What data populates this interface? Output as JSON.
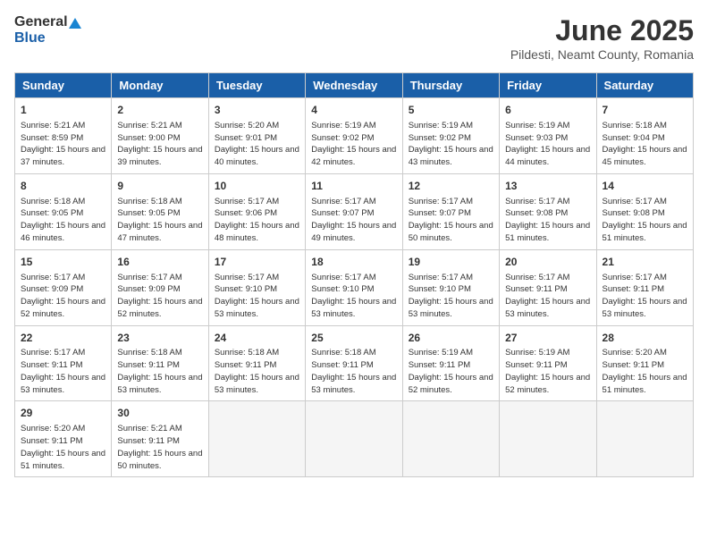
{
  "header": {
    "logo_general": "General",
    "logo_blue": "Blue",
    "title": "June 2025",
    "subtitle": "Pildesti, Neamt County, Romania"
  },
  "calendar": {
    "days_of_week": [
      "Sunday",
      "Monday",
      "Tuesday",
      "Wednesday",
      "Thursday",
      "Friday",
      "Saturday"
    ],
    "weeks": [
      [
        {
          "day": "",
          "info": ""
        },
        {
          "day": "2",
          "info": "Sunrise: 5:21 AM\nSunset: 9:00 PM\nDaylight: 15 hours\nand 39 minutes."
        },
        {
          "day": "3",
          "info": "Sunrise: 5:20 AM\nSunset: 9:01 PM\nDaylight: 15 hours\nand 40 minutes."
        },
        {
          "day": "4",
          "info": "Sunrise: 5:19 AM\nSunset: 9:02 PM\nDaylight: 15 hours\nand 42 minutes."
        },
        {
          "day": "5",
          "info": "Sunrise: 5:19 AM\nSunset: 9:02 PM\nDaylight: 15 hours\nand 43 minutes."
        },
        {
          "day": "6",
          "info": "Sunrise: 5:19 AM\nSunset: 9:03 PM\nDaylight: 15 hours\nand 44 minutes."
        },
        {
          "day": "7",
          "info": "Sunrise: 5:18 AM\nSunset: 9:04 PM\nDaylight: 15 hours\nand 45 minutes."
        }
      ],
      [
        {
          "day": "1",
          "info": "Sunrise: 5:21 AM\nSunset: 8:59 PM\nDaylight: 15 hours\nand 37 minutes."
        },
        {
          "day": "",
          "info": ""
        },
        {
          "day": "",
          "info": ""
        },
        {
          "day": "",
          "info": ""
        },
        {
          "day": "",
          "info": ""
        },
        {
          "day": "",
          "info": ""
        },
        {
          "day": "",
          "info": ""
        }
      ],
      [
        {
          "day": "8",
          "info": "Sunrise: 5:18 AM\nSunset: 9:05 PM\nDaylight: 15 hours\nand 46 minutes."
        },
        {
          "day": "9",
          "info": "Sunrise: 5:18 AM\nSunset: 9:05 PM\nDaylight: 15 hours\nand 47 minutes."
        },
        {
          "day": "10",
          "info": "Sunrise: 5:17 AM\nSunset: 9:06 PM\nDaylight: 15 hours\nand 48 minutes."
        },
        {
          "day": "11",
          "info": "Sunrise: 5:17 AM\nSunset: 9:07 PM\nDaylight: 15 hours\nand 49 minutes."
        },
        {
          "day": "12",
          "info": "Sunrise: 5:17 AM\nSunset: 9:07 PM\nDaylight: 15 hours\nand 50 minutes."
        },
        {
          "day": "13",
          "info": "Sunrise: 5:17 AM\nSunset: 9:08 PM\nDaylight: 15 hours\nand 51 minutes."
        },
        {
          "day": "14",
          "info": "Sunrise: 5:17 AM\nSunset: 9:08 PM\nDaylight: 15 hours\nand 51 minutes."
        }
      ],
      [
        {
          "day": "15",
          "info": "Sunrise: 5:17 AM\nSunset: 9:09 PM\nDaylight: 15 hours\nand 52 minutes."
        },
        {
          "day": "16",
          "info": "Sunrise: 5:17 AM\nSunset: 9:09 PM\nDaylight: 15 hours\nand 52 minutes."
        },
        {
          "day": "17",
          "info": "Sunrise: 5:17 AM\nSunset: 9:10 PM\nDaylight: 15 hours\nand 53 minutes."
        },
        {
          "day": "18",
          "info": "Sunrise: 5:17 AM\nSunset: 9:10 PM\nDaylight: 15 hours\nand 53 minutes."
        },
        {
          "day": "19",
          "info": "Sunrise: 5:17 AM\nSunset: 9:10 PM\nDaylight: 15 hours\nand 53 minutes."
        },
        {
          "day": "20",
          "info": "Sunrise: 5:17 AM\nSunset: 9:11 PM\nDaylight: 15 hours\nand 53 minutes."
        },
        {
          "day": "21",
          "info": "Sunrise: 5:17 AM\nSunset: 9:11 PM\nDaylight: 15 hours\nand 53 minutes."
        }
      ],
      [
        {
          "day": "22",
          "info": "Sunrise: 5:17 AM\nSunset: 9:11 PM\nDaylight: 15 hours\nand 53 minutes."
        },
        {
          "day": "23",
          "info": "Sunrise: 5:18 AM\nSunset: 9:11 PM\nDaylight: 15 hours\nand 53 minutes."
        },
        {
          "day": "24",
          "info": "Sunrise: 5:18 AM\nSunset: 9:11 PM\nDaylight: 15 hours\nand 53 minutes."
        },
        {
          "day": "25",
          "info": "Sunrise: 5:18 AM\nSunset: 9:11 PM\nDaylight: 15 hours\nand 53 minutes."
        },
        {
          "day": "26",
          "info": "Sunrise: 5:19 AM\nSunset: 9:11 PM\nDaylight: 15 hours\nand 52 minutes."
        },
        {
          "day": "27",
          "info": "Sunrise: 5:19 AM\nSunset: 9:11 PM\nDaylight: 15 hours\nand 52 minutes."
        },
        {
          "day": "28",
          "info": "Sunrise: 5:20 AM\nSunset: 9:11 PM\nDaylight: 15 hours\nand 51 minutes."
        }
      ],
      [
        {
          "day": "29",
          "info": "Sunrise: 5:20 AM\nSunset: 9:11 PM\nDaylight: 15 hours\nand 51 minutes."
        },
        {
          "day": "30",
          "info": "Sunrise: 5:21 AM\nSunset: 9:11 PM\nDaylight: 15 hours\nand 50 minutes."
        },
        {
          "day": "",
          "info": ""
        },
        {
          "day": "",
          "info": ""
        },
        {
          "day": "",
          "info": ""
        },
        {
          "day": "",
          "info": ""
        },
        {
          "day": "",
          "info": ""
        }
      ]
    ]
  }
}
